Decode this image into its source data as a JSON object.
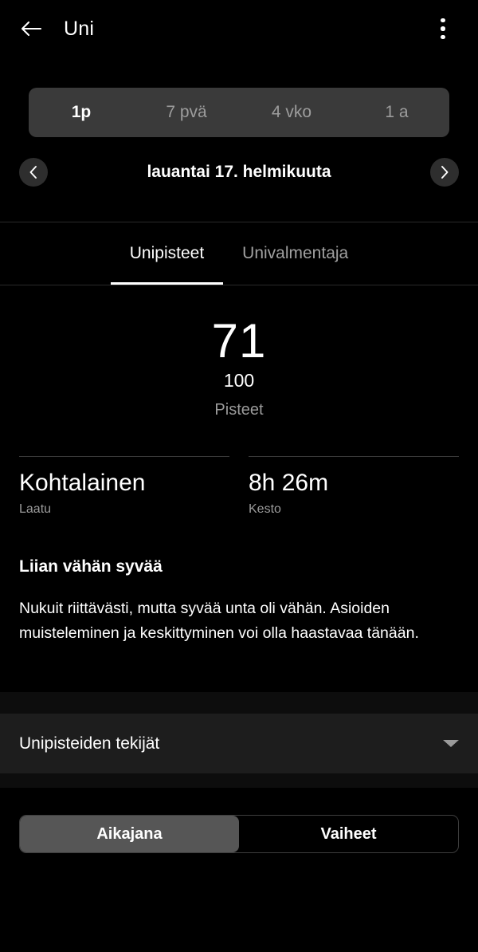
{
  "appbar": {
    "back_icon": "arrow-left-icon",
    "title": "Uni",
    "overflow_icon": "more-vertical-icon"
  },
  "range_selector": {
    "options": [
      {
        "label": "1p",
        "active": true
      },
      {
        "label": "7 pvä",
        "active": false
      },
      {
        "label": "4 vko",
        "active": false
      },
      {
        "label": "1 a",
        "active": false
      }
    ]
  },
  "date_nav": {
    "prev_icon": "chevron-left-icon",
    "next_icon": "chevron-right-icon",
    "date": "lauantai 17. helmikuuta"
  },
  "tabs": [
    {
      "label": "Unipisteet",
      "active": true
    },
    {
      "label": "Univalmentaja",
      "active": false
    }
  ],
  "score": {
    "value": "71",
    "max": "100",
    "unit": "Pisteet"
  },
  "metrics": [
    {
      "value": "Kohtalainen",
      "label": "Laatu"
    },
    {
      "value": "8h 26m",
      "label": "Kesto"
    }
  ],
  "insight": {
    "title": "Liian vähän syvää",
    "body": "Nukuit riittävästi, mutta syvää unta oli vähän. Asioiden muisteleminen ja keskittyminen voi olla haastavaa tänään."
  },
  "accordion": {
    "label": "Unipisteiden tekijät",
    "caret_icon": "chevron-down-icon"
  },
  "bottom_toggle": {
    "options": [
      {
        "label": "Aikajana",
        "active": true
      },
      {
        "label": "Vaiheet",
        "active": false
      }
    ]
  },
  "colors": {
    "background": "#000000",
    "segment_bar": "#3a3a3a",
    "segment_active": "#565656",
    "panel": "#1d1d1d",
    "muted_text": "#9b9b9b",
    "accent_text": "#ffffff"
  }
}
